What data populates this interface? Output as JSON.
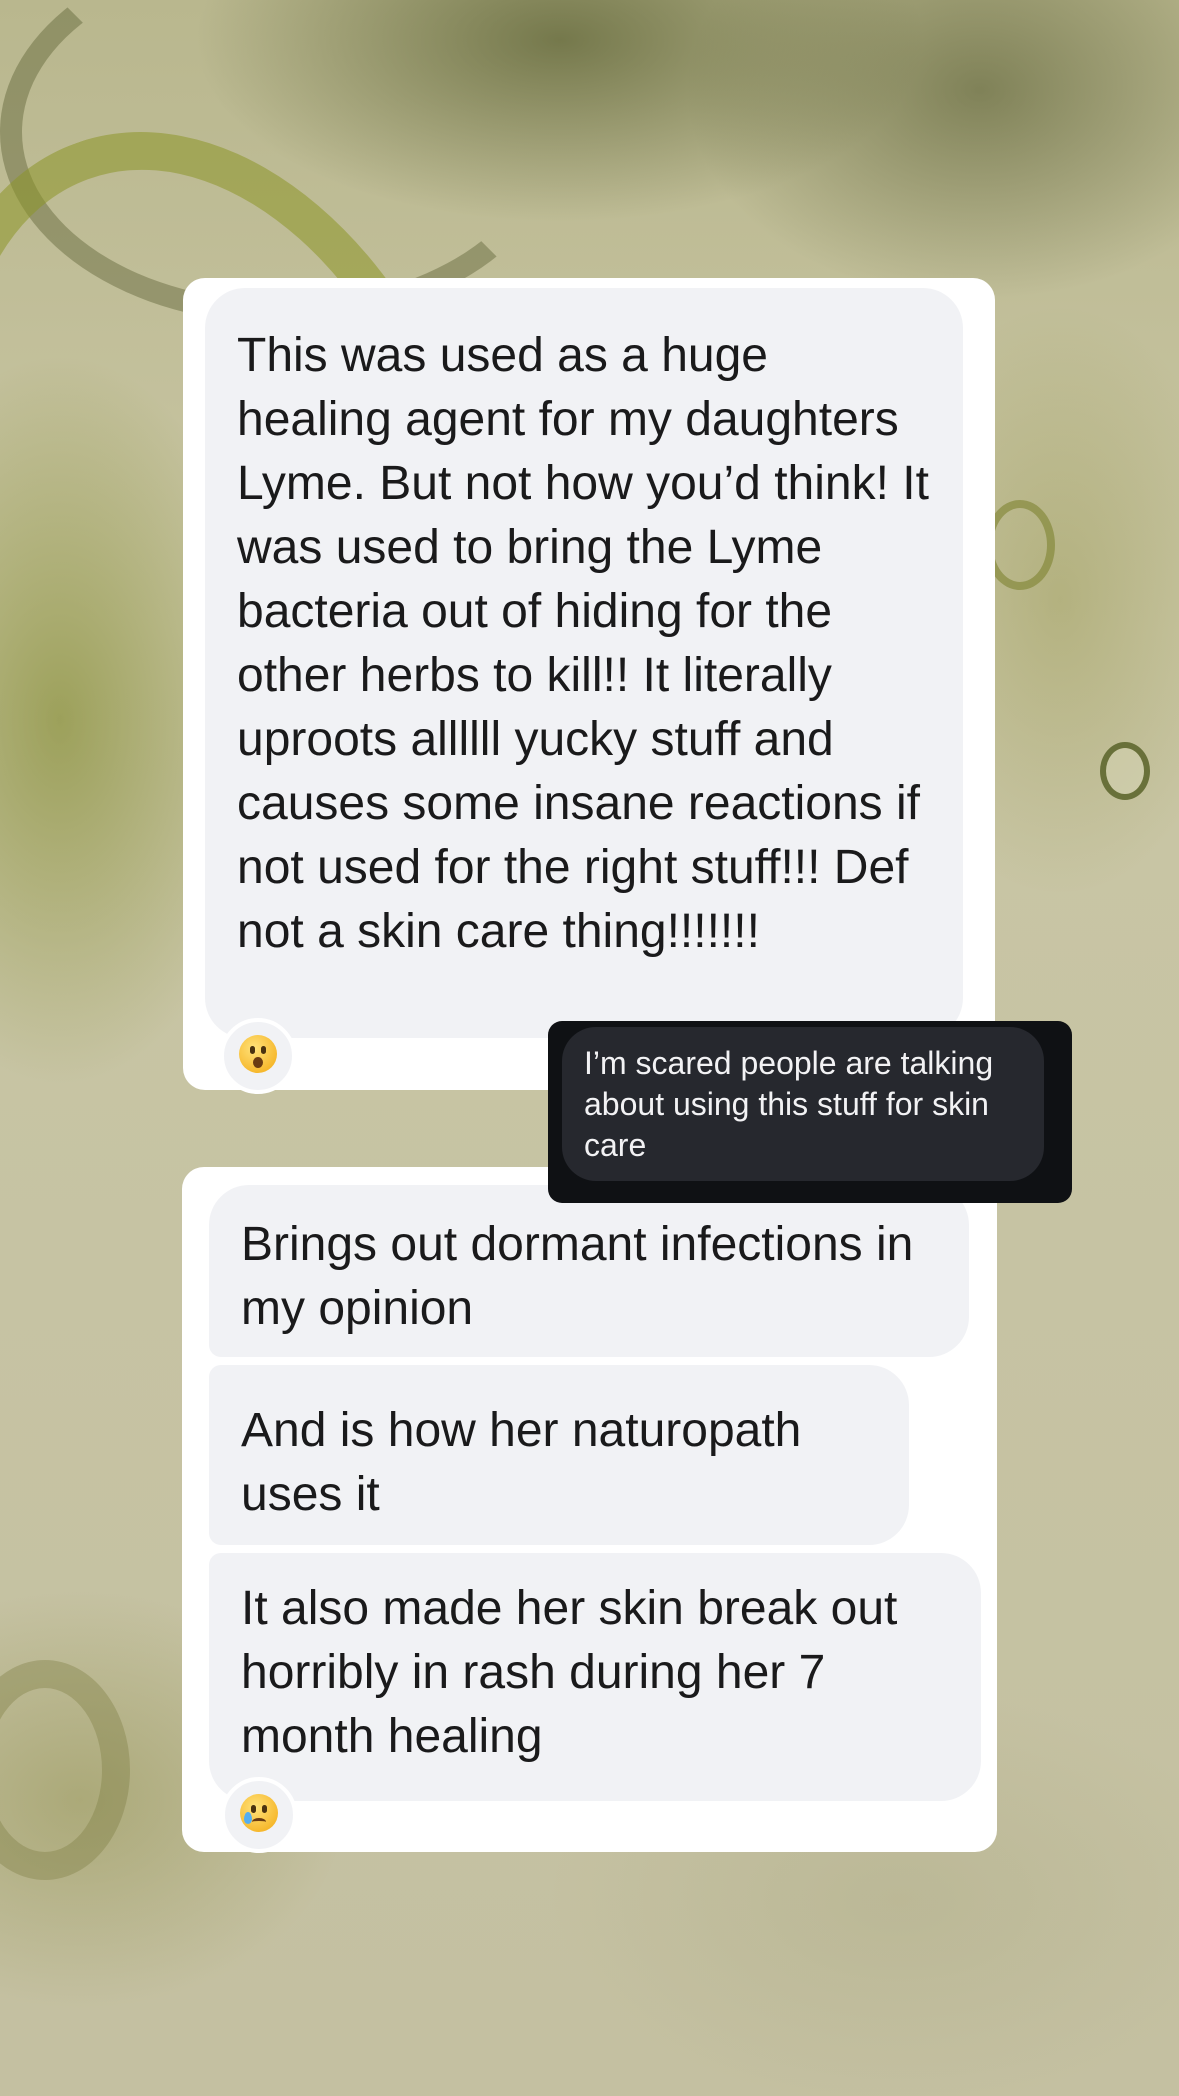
{
  "message_group_1": {
    "bubbles": [
      {
        "text": "This was used as a huge healing agent for my daughters Lyme. But not how you’d think! It was used to bring the Lyme bacteria out of hiding for the other herbs to kill!! It literally uproots allllll yucky stuff and causes some insane reactions if not used for the right stuff!!! Def not a skin care thing!!!!!!!"
      }
    ],
    "reaction": {
      "icon": "hushed-face-emoji",
      "glyph": "😮"
    }
  },
  "caption": {
    "text": "I’m scared people are talking about using this stuff for skin care"
  },
  "message_group_2": {
    "bubbles": [
      {
        "text": "Brings out dormant infections in my opinion"
      },
      {
        "text": "And is how her naturopath uses it"
      },
      {
        "text": "It also made her skin break out horribly in rash during her 7 month healing"
      }
    ],
    "reaction": {
      "icon": "crying-face-emoji",
      "glyph": "😢"
    }
  },
  "colors": {
    "bubble_background": "#f1f2f5",
    "bubble_text": "#1a1a1b",
    "card_background": "#ffffff",
    "caption_background": "#26282e",
    "caption_text": "#f2f2f4"
  }
}
